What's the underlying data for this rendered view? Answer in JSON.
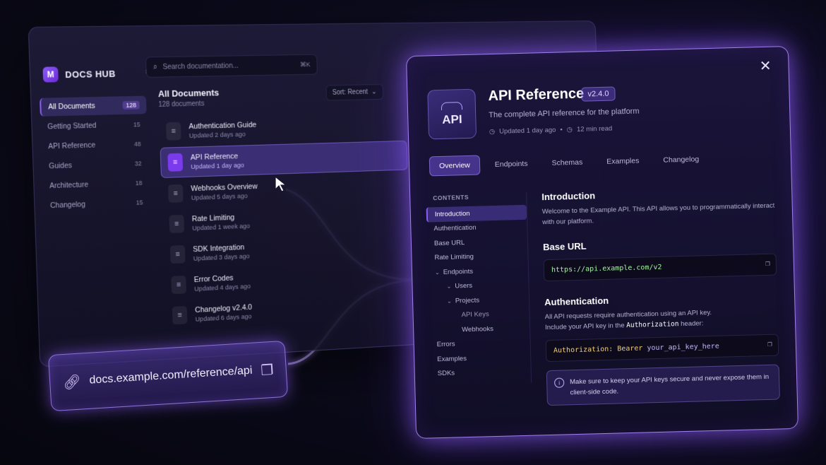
{
  "brand": {
    "name": "DOCS HUB",
    "logo_glyph": "M",
    "caret": "↕"
  },
  "search": {
    "placeholder": "Search documentation...",
    "shortcut": "⌘K"
  },
  "sidebar": {
    "items": [
      {
        "label": "All Documents",
        "count": "128",
        "active": true
      },
      {
        "label": "Getting Started",
        "count": "15"
      },
      {
        "label": "API Reference",
        "count": "48"
      },
      {
        "label": "Guides",
        "count": "32"
      },
      {
        "label": "Architecture",
        "count": "18"
      },
      {
        "label": "Changelog",
        "count": "15"
      }
    ]
  },
  "doclist": {
    "title": "All Documents",
    "subtitle": "128 documents",
    "sort_label": "Sort: Recent",
    "rows": [
      {
        "name": "Authentication Guide",
        "meta": "Updated 2 days ago"
      },
      {
        "name": "API Reference",
        "meta": "Updated 1 day ago",
        "active": true
      },
      {
        "name": "Webhooks Overview",
        "meta": "Updated 5 days ago"
      },
      {
        "name": "Rate Limiting",
        "meta": "Updated 1 week ago"
      },
      {
        "name": "SDK Integration",
        "meta": "Updated 3 days ago"
      },
      {
        "name": "Error Codes",
        "meta": "Updated 4 days ago"
      },
      {
        "name": "Changelog v2.4.0",
        "meta": "Updated 6 days ago"
      }
    ]
  },
  "link_pill": {
    "url": "docs.example.com/reference/api"
  },
  "api_doc": {
    "logo_text": "API",
    "title": "API Reference",
    "version": "v2.4.0",
    "subtitle": "The complete API reference for the platform",
    "updated": "Updated 1 day ago",
    "read_time": "12 min read",
    "tabs": [
      "Overview",
      "Endpoints",
      "Schemas",
      "Examples",
      "Changelog"
    ],
    "contents_label": "CONTENTS",
    "toc": {
      "introduction": "Introduction",
      "authentication": "Authentication",
      "base_url": "Base URL",
      "rate_limiting": "Rate Limiting",
      "endpoints": "Endpoints",
      "users": "Users",
      "projects": "Projects",
      "api_keys": "API Keys",
      "webhooks": "Webhooks",
      "errors": "Errors",
      "examples": "Examples",
      "sdks": "SDKs"
    },
    "intro": {
      "heading": "Introduction",
      "text": "Welcome to the Example API. This API allows you to programmatically interact with our platform."
    },
    "base_url": {
      "heading": "Base URL",
      "code": "https://api.example.com/v2"
    },
    "auth": {
      "heading": "Authentication",
      "text1": "All API requests require authentication using an API key.",
      "text2_pre": "Include your API key in the",
      "text2_code": "Authorization",
      "text2_post": "header:",
      "code_key": "Authorization:",
      "code_bearer": "Bearer",
      "code_value": "your_api_key_here"
    },
    "note": "Make sure to keep your API keys secure and never expose them in client-side code."
  },
  "colors": {
    "accent": "#8b5cf6",
    "glow": "#a78bfa",
    "background": "#0b0a1c"
  }
}
